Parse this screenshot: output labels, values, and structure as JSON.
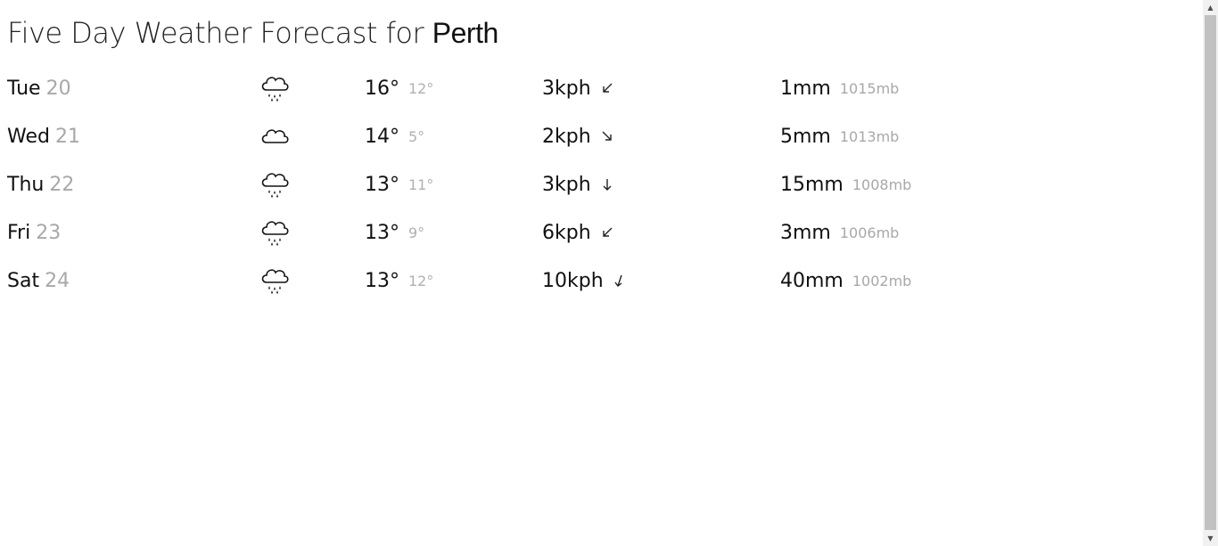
{
  "header": {
    "title_prefix": "Five Day Weather Forecast for ",
    "city": "Perth"
  },
  "forecast": [
    {
      "day": "Tue",
      "date": "20",
      "icon": "rain-cloud-icon",
      "high": "16°",
      "low": "12°",
      "wind": "3kph",
      "wind_direction": "south-west",
      "rain": "1mm",
      "pressure": "1015mb"
    },
    {
      "day": "Wed",
      "date": "21",
      "icon": "cloud-icon",
      "high": "14°",
      "low": "5°",
      "wind": "2kph",
      "wind_direction": "south-east",
      "rain": "5mm",
      "pressure": "1013mb"
    },
    {
      "day": "Thu",
      "date": "22",
      "icon": "rain-cloud-icon",
      "high": "13°",
      "low": "11°",
      "wind": "3kph",
      "wind_direction": "south",
      "rain": "15mm",
      "pressure": "1008mb"
    },
    {
      "day": "Fri",
      "date": "23",
      "icon": "rain-cloud-icon",
      "high": "13°",
      "low": "9°",
      "wind": "6kph",
      "wind_direction": "south-west",
      "rain": "3mm",
      "pressure": "1006mb"
    },
    {
      "day": "Sat",
      "date": "24",
      "icon": "rain-cloud-icon",
      "high": "13°",
      "low": "12°",
      "wind": "10kph",
      "wind_direction": "south-southwest",
      "rain": "40mm",
      "pressure": "1002mb"
    }
  ],
  "colors": {
    "primary_text": "#111111",
    "secondary_text": "#a8a8a8"
  }
}
